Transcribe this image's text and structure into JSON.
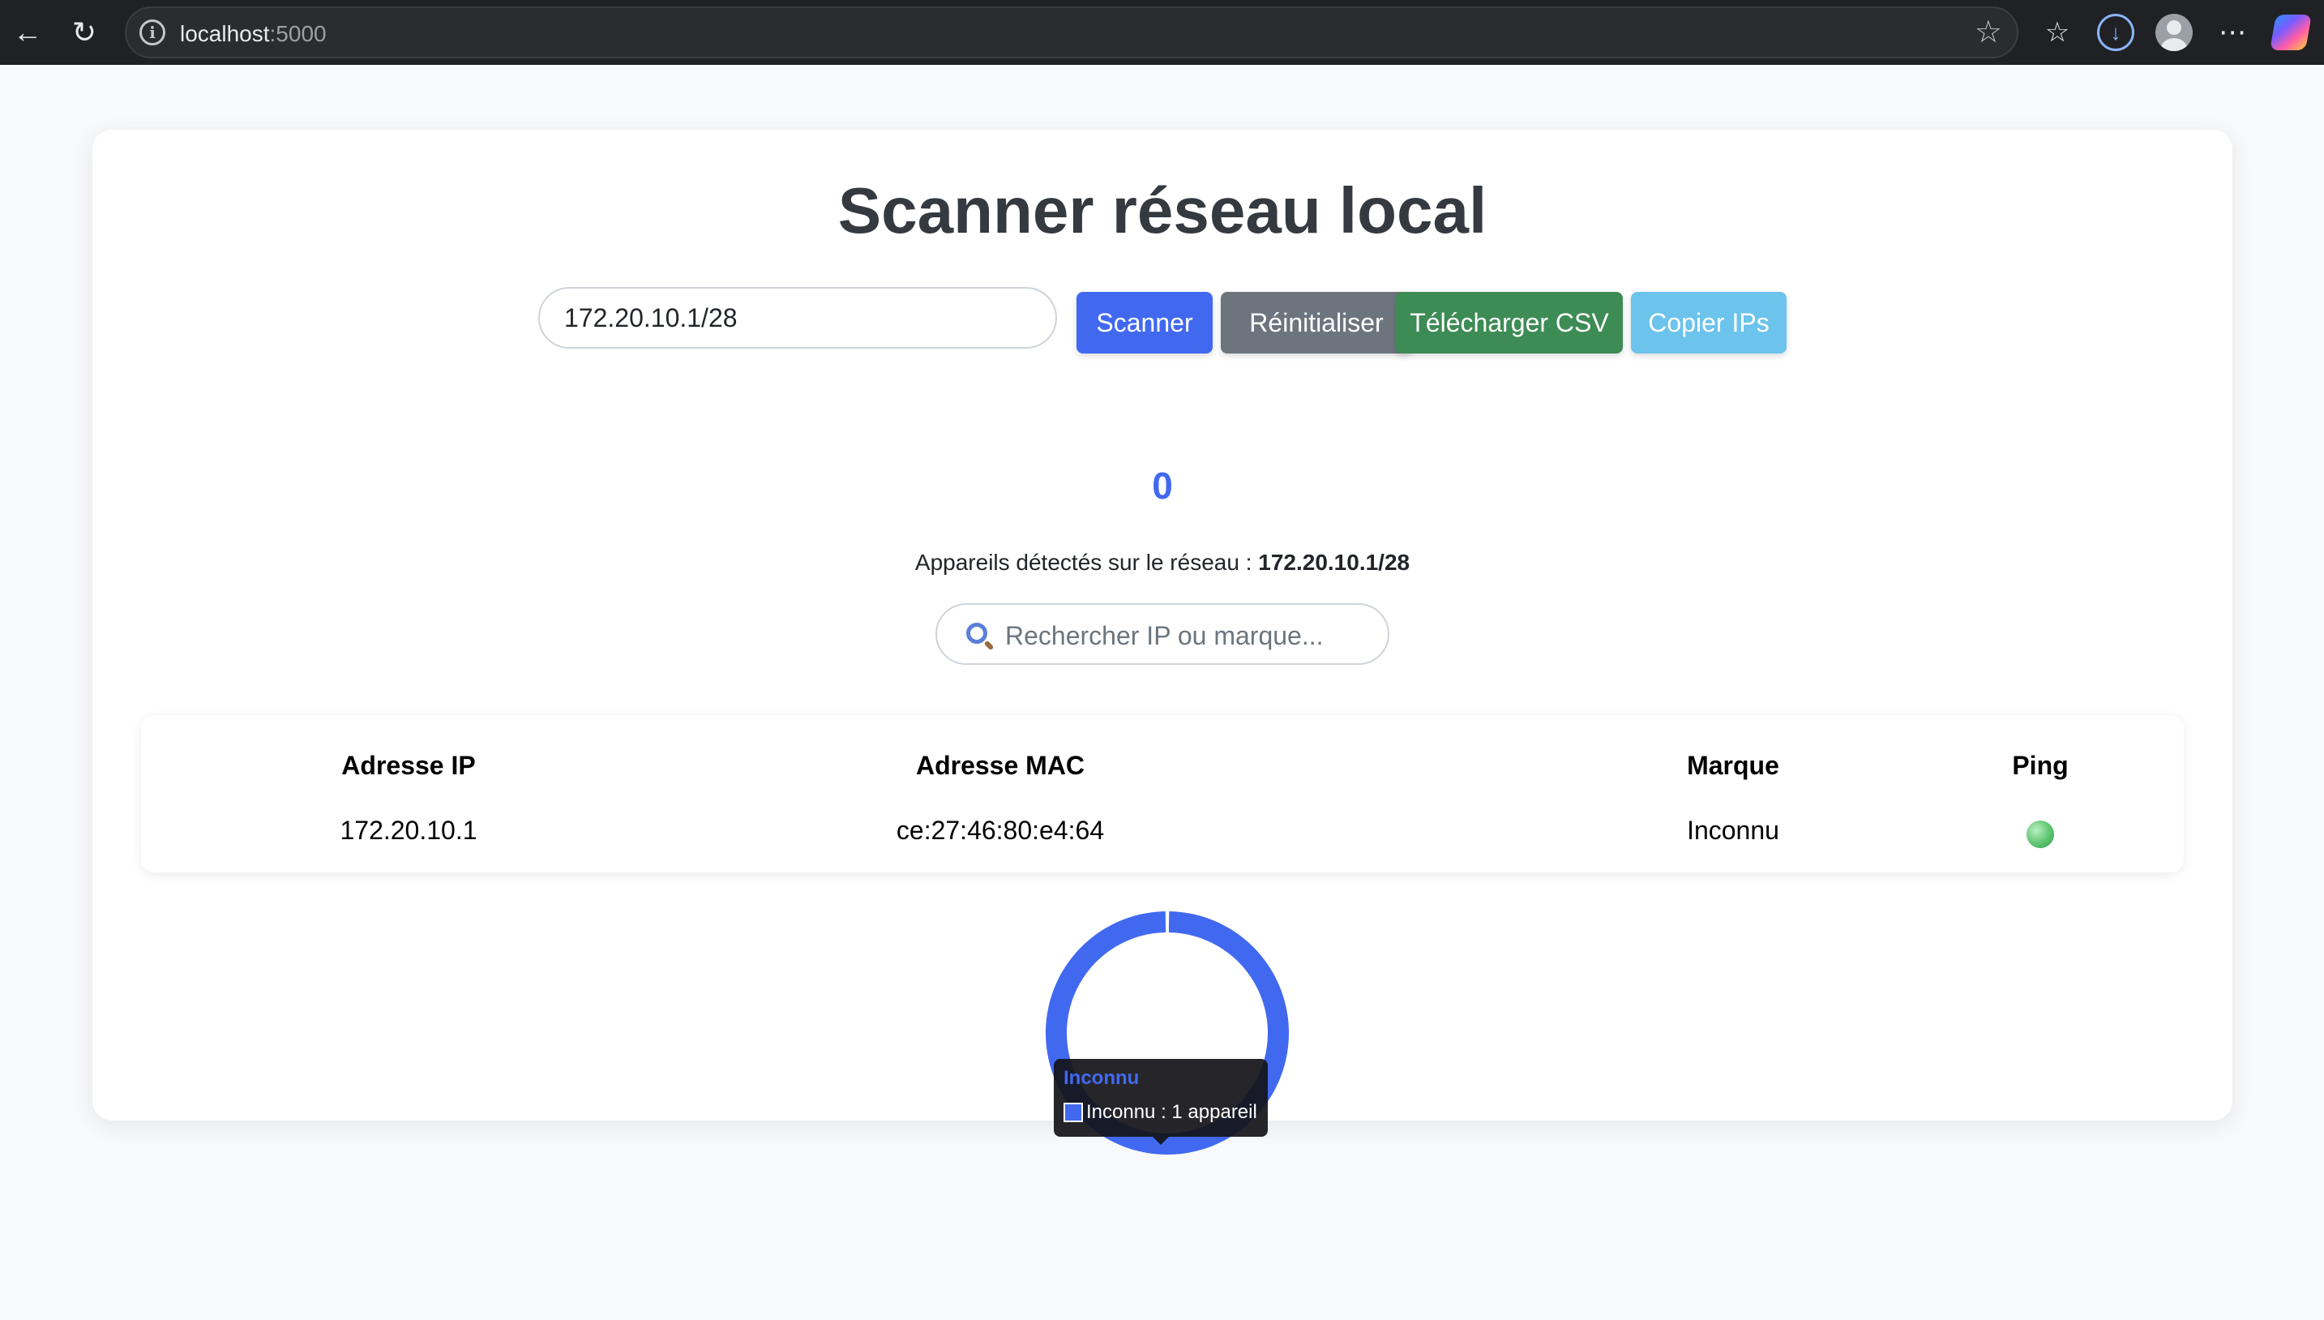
{
  "browser": {
    "url_host": "localhost",
    "url_port": ":5000"
  },
  "app": {
    "title": "Scanner réseau local",
    "network_input_value": "172.20.10.1/28",
    "buttons": {
      "scan": "Scanner",
      "reset": "Réinitialiser",
      "download_csv": "Télécharger CSV",
      "copy_ips": "Copier IPs"
    },
    "counter": "0",
    "detected_prefix": "Appareils détectés sur le réseau :",
    "detected_network": "172.20.10.1/28",
    "search_placeholder": "Rechercher IP ou marque..."
  },
  "table": {
    "headers": [
      "Adresse IP",
      "Adresse MAC",
      "Marque",
      "Ping"
    ],
    "rows": [
      {
        "ip": "172.20.10.1",
        "mac": "ce:27:46:80:e4:64",
        "brand": "Inconnu",
        "ping": "online"
      }
    ]
  },
  "chart_data": {
    "type": "pie",
    "categories": [
      "Inconnu"
    ],
    "values": [
      1
    ],
    "colors": [
      "#4169f0"
    ],
    "tooltip": {
      "title": "Inconnu",
      "label": "Inconnu : 1 appareil"
    }
  },
  "colors": {
    "accent": "#4169f0",
    "reset": "#6c757d",
    "csv": "#3d8b55",
    "copy": "#6cc3ec",
    "ping_online": "#5cc46f"
  }
}
